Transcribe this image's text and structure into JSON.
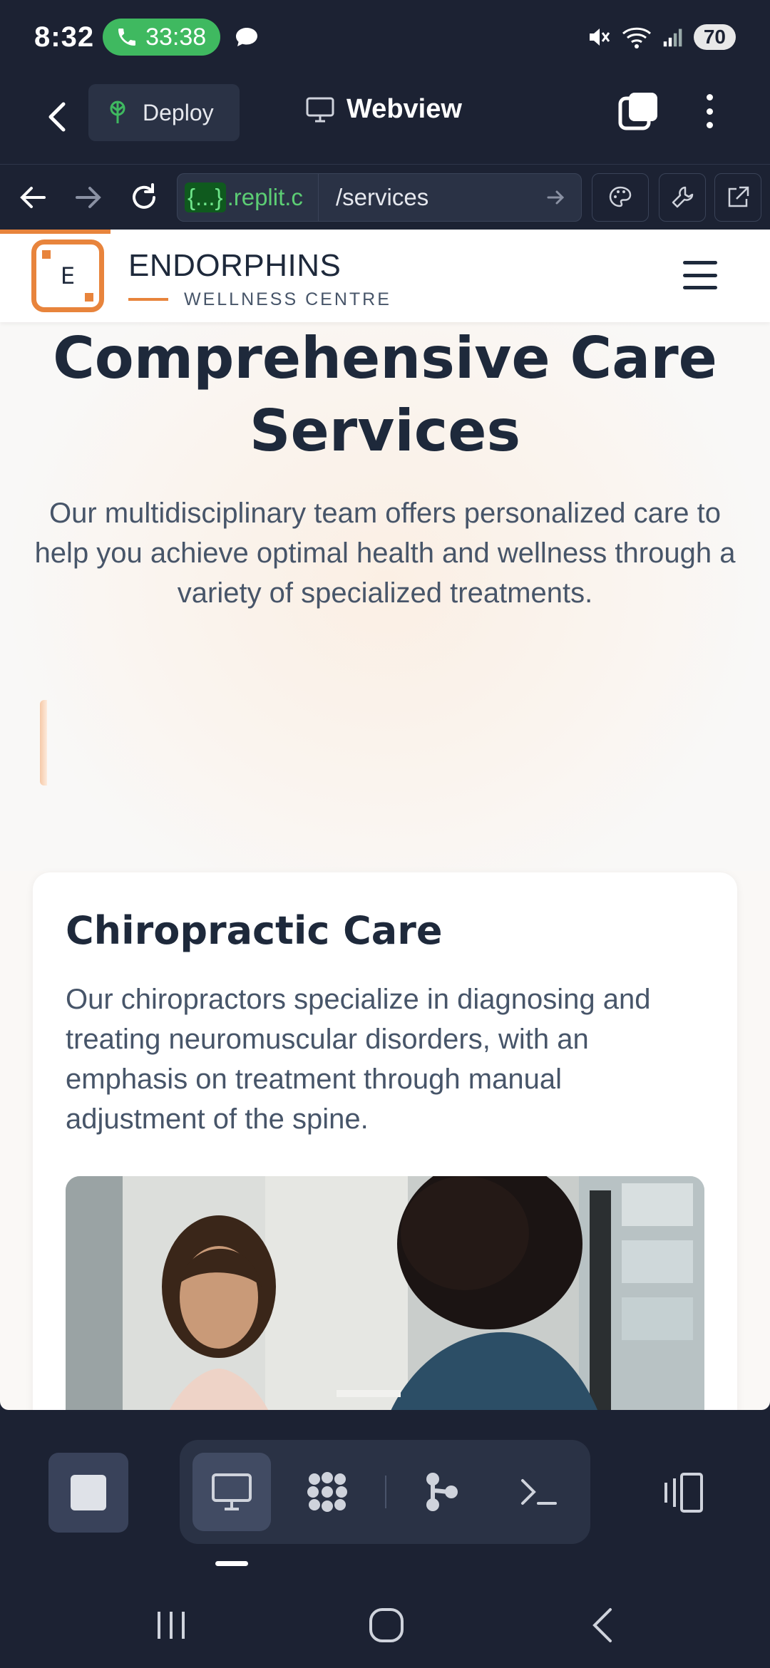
{
  "status_bar": {
    "time": "8:32",
    "call_timer": "33:38",
    "battery": "70"
  },
  "app_bar": {
    "deploy_label": "Deploy",
    "webview_label": "Webview"
  },
  "browser": {
    "url_host_braces": "{...}",
    "url_host": ".replit.c",
    "url_path": "/services"
  },
  "site": {
    "logo_letter": "E",
    "brand_name": "ENDORPHINS",
    "brand_sub": "WELLNESS CENTRE",
    "hero_title": "Comprehensive Care Services",
    "hero_description": "Our multidisciplinary team offers personalized care to help you achieve optimal health and wellness through a variety of specialized treatments.",
    "services": [
      {
        "title": "Chiropractic Care",
        "description": "Our chiropractors specialize in diagnosing and treating neuromuscular disorders, with an emphasis on treatment through manual adjustment of the spine."
      }
    ]
  },
  "colors": {
    "accent": "#e8843c",
    "dark_bg": "#1c2233",
    "call_green": "#3fb960",
    "url_green": "#5ccd74"
  },
  "icons": {
    "dock": [
      "stop-icon",
      "monitor-icon",
      "grid-dots-icon",
      "git-branch-icon",
      "terminal-icon",
      "device-toggle-icon"
    ]
  }
}
